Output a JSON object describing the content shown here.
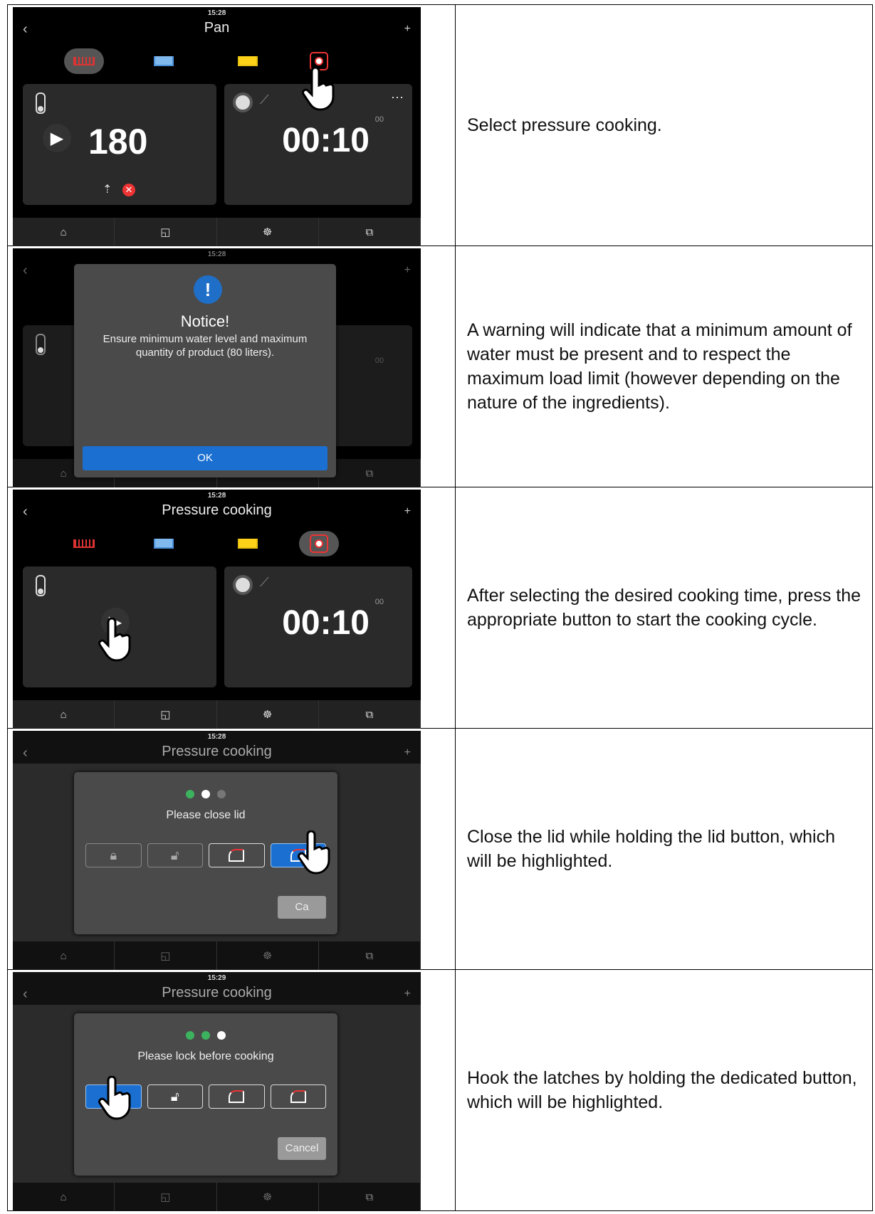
{
  "rows": [
    {
      "screen": {
        "clock": "15:28",
        "title": "Pan",
        "temp": "180",
        "time": "00:10",
        "time_sup": "00"
      },
      "description": "Select pressure cooking."
    },
    {
      "screen": {
        "clock": "15:28",
        "notice_title": "Notice!",
        "notice_text": "Ensure minimum water level and maximum quantity of product (80 liters).",
        "ok": "OK",
        "time_sup": "00"
      },
      "description": "A warning will indicate that a minimum amount of water must be present and to respect the maximum load limit (however depending on the nature of the ingredients)."
    },
    {
      "screen": {
        "clock": "15:28",
        "title": "Pressure cooking",
        "time": "00:10",
        "time_sup": "00"
      },
      "description": "After selecting the desired cooking time, press the appropriate button to start the cooking cycle."
    },
    {
      "screen": {
        "clock": "15:28",
        "title": "Pressure cooking",
        "message": "Please close lid",
        "cancel": "Ca"
      },
      "description": "Close the lid while holding the lid button, which will be highlighted."
    },
    {
      "screen": {
        "clock": "15:29",
        "title": "Pressure cooking",
        "message": "Please lock before cooking",
        "cancel": "Cancel"
      },
      "description": "Hook the latches by holding the dedicated button, which will be highlighted."
    }
  ],
  "icons": {
    "back": "chevron-left-icon",
    "add": "plus-icon",
    "home": "home-icon",
    "pressure": "pressure-icon"
  },
  "colors": {
    "accent": "#1a6fd1",
    "ok_step": "#3db25e",
    "alert": "#e33333"
  }
}
